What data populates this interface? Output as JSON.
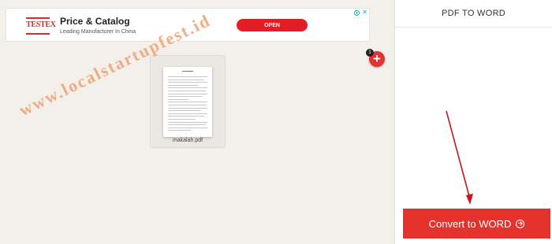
{
  "ad": {
    "logo_text": "TESTEX",
    "title": "Price & Catalog",
    "subtitle": "Leading Manufacturer In China",
    "cta_label": "OPEN",
    "close_glyph": "✕"
  },
  "files": [
    {
      "name": "makalah.pdf"
    }
  ],
  "add_button": {
    "glyph": "+",
    "file_count": "1"
  },
  "sidebar": {
    "title": "PDF TO WORD",
    "convert_label": "Convert to WORD"
  },
  "watermark": "www.localstartupfest.id",
  "colors": {
    "accent": "#e5322d",
    "watermark": "#f0a270",
    "info_icon": "#00a8e8"
  }
}
